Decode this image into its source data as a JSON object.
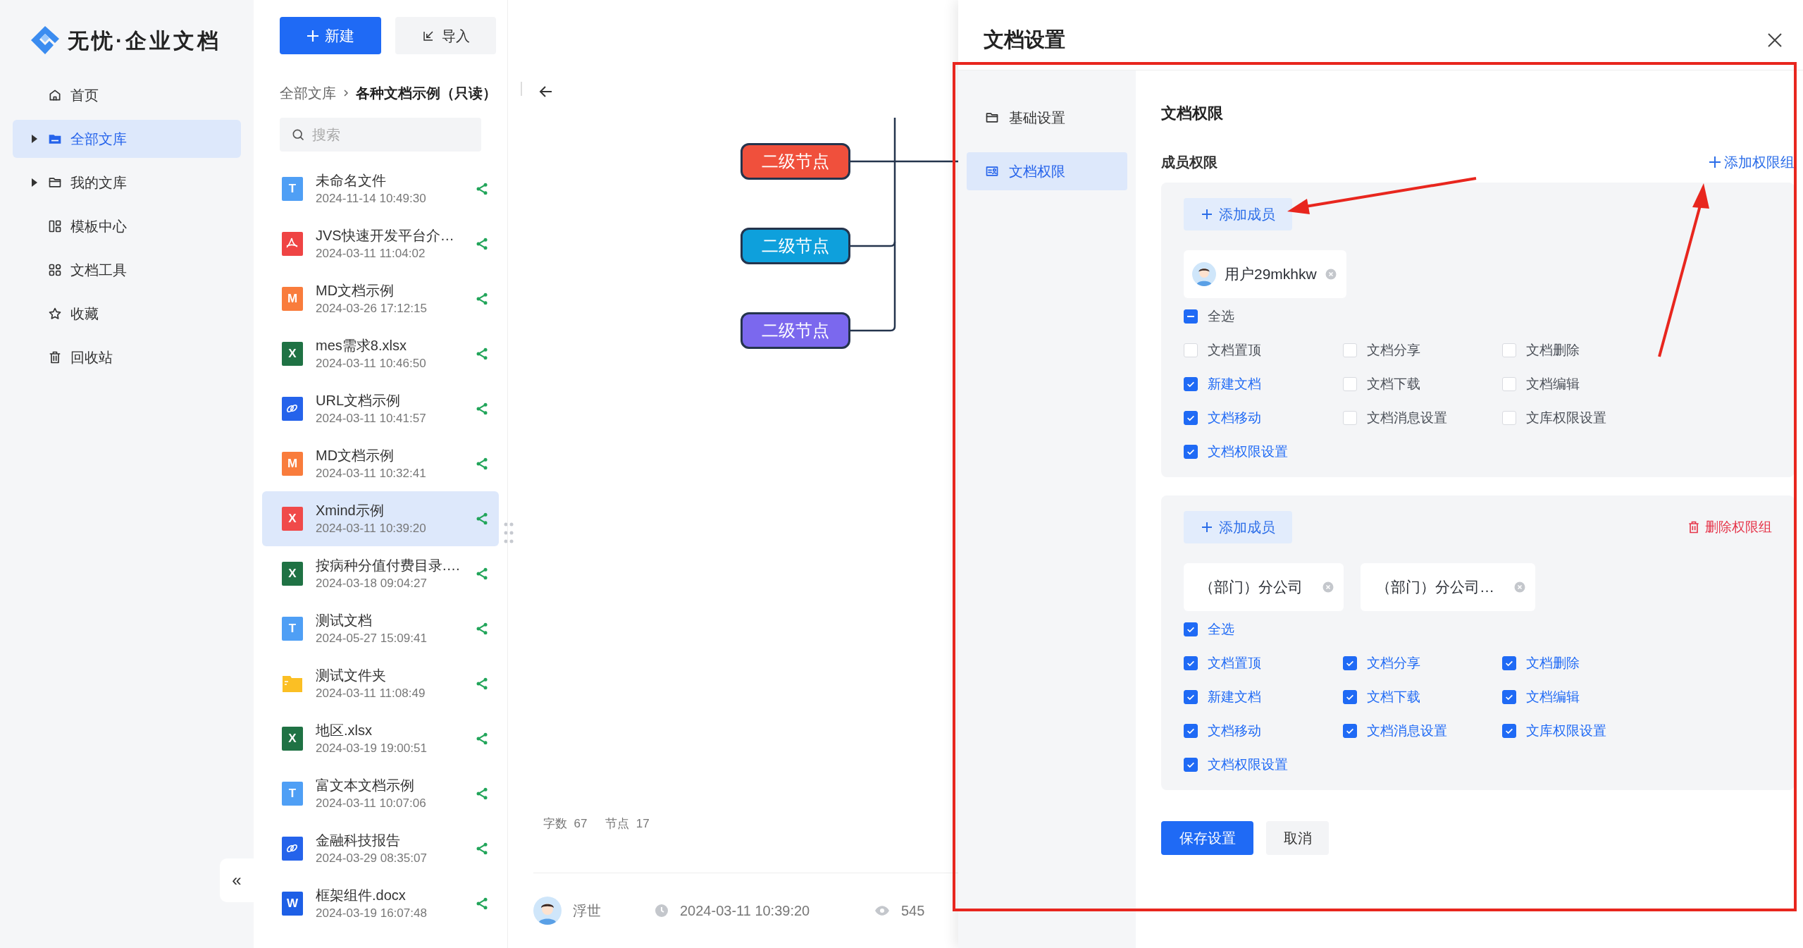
{
  "brand": {
    "title": "无忧·企业文档"
  },
  "sidebar": {
    "items": [
      {
        "label": "首页",
        "expandable": false,
        "selected": false
      },
      {
        "label": "全部文库",
        "expandable": true,
        "selected": true
      },
      {
        "label": "我的文库",
        "expandable": true,
        "selected": false
      },
      {
        "label": "模板中心",
        "expandable": false,
        "selected": false
      },
      {
        "label": "文档工具",
        "expandable": false,
        "selected": false
      },
      {
        "label": "收藏",
        "expandable": false,
        "selected": false
      },
      {
        "label": "回收站",
        "expandable": false,
        "selected": false
      }
    ],
    "collapse_button": "«"
  },
  "toolbar": {
    "new_button": "新建",
    "import_button": "导入"
  },
  "breadcrumb": {
    "root": "全部文库",
    "current": "各种文档示例（只读）"
  },
  "search": {
    "placeholder": "搜索"
  },
  "files": [
    {
      "kind": "text",
      "letter": "T",
      "name": "未命名文件",
      "date": "2024-11-14 10:49:30",
      "selected": false
    },
    {
      "kind": "pdf",
      "name": "JVS快速开发平台介…",
      "date": "2024-03-11 11:04:02",
      "selected": false
    },
    {
      "kind": "md",
      "letter": "M",
      "name": "MD文档示例",
      "date": "2024-03-26 17:12:15",
      "selected": false
    },
    {
      "kind": "excel",
      "letter": "X",
      "name": "mes需求8.xlsx",
      "date": "2024-03-11 10:46:50",
      "selected": false
    },
    {
      "kind": "link",
      "name": "URL文档示例",
      "date": "2024-03-11 10:41:57",
      "selected": false
    },
    {
      "kind": "md",
      "letter": "M",
      "name": "MD文档示例",
      "date": "2024-03-11 10:32:41",
      "selected": false
    },
    {
      "kind": "xmind",
      "letter": "X",
      "name": "Xmind示例",
      "date": "2024-03-11 10:39:20",
      "selected": true
    },
    {
      "kind": "excel",
      "letter": "X",
      "name": "按病种分值付费目录.…",
      "date": "2024-03-18 09:04:27",
      "selected": false
    },
    {
      "kind": "text",
      "letter": "T",
      "name": "测试文档",
      "date": "2024-05-27 15:09:41",
      "selected": false
    },
    {
      "kind": "folder",
      "name": "测试文件夹",
      "date": "2024-03-11 11:08:49",
      "selected": false
    },
    {
      "kind": "excel",
      "letter": "X",
      "name": "地区.xlsx",
      "date": "2024-03-19 19:00:51",
      "selected": false
    },
    {
      "kind": "text",
      "letter": "T",
      "name": "富文本文档示例",
      "date": "2024-03-11 10:07:06",
      "selected": false
    },
    {
      "kind": "link",
      "name": "金融科技报告",
      "date": "2024-03-29 08:35:07",
      "selected": false
    },
    {
      "kind": "word",
      "letter": "W",
      "name": "框架组件.docx",
      "date": "2024-03-19 16:07:48",
      "selected": false
    }
  ],
  "mindmap": {
    "nodes": [
      {
        "label": "二级节点",
        "color": "#f0503c"
      },
      {
        "label": "二级节点",
        "color": "#0ea0dc"
      },
      {
        "label": "二级节点",
        "color": "#7b68ee"
      }
    ],
    "stats": [
      {
        "label": "字数",
        "value": "67"
      },
      {
        "label": "节点",
        "value": "17"
      }
    ]
  },
  "doc_footer": {
    "author": "浮世",
    "time": "2024-03-11 10:39:20",
    "views": "545"
  },
  "drawer": {
    "title": "文档设置",
    "nav": [
      {
        "label": "基础设置",
        "selected": false
      },
      {
        "label": "文档权限",
        "selected": true
      }
    ],
    "heading": "文档权限",
    "section": "成员权限",
    "add_group": "添加权限组",
    "groups": [
      {
        "add_member": "添加成员",
        "members": [
          {
            "kind": "user",
            "name": "用户29mkhkw"
          }
        ],
        "select_all": {
          "label": "全选",
          "checked": false,
          "indeterminate": true
        },
        "permissions": [
          {
            "label": "文档置顶",
            "checked": false
          },
          {
            "label": "文档分享",
            "checked": false
          },
          {
            "label": "文档删除",
            "checked": false
          },
          {
            "label": "新建文档",
            "checked": true
          },
          {
            "label": "文档下载",
            "checked": false
          },
          {
            "label": "文档编辑",
            "checked": false
          },
          {
            "label": "文档移动",
            "checked": true
          },
          {
            "label": "文档消息设置",
            "checked": false
          },
          {
            "label": "文库权限设置",
            "checked": false
          },
          {
            "label": "文档权限设置",
            "checked": true
          }
        ]
      },
      {
        "add_member": "添加成员",
        "delete_group": "删除权限组",
        "members": [
          {
            "kind": "department",
            "name": "（部门）分公司"
          },
          {
            "kind": "department",
            "name": "（部门）分公司…"
          }
        ],
        "select_all": {
          "label": "全选",
          "checked": true,
          "indeterminate": false
        },
        "permissions": [
          {
            "label": "文档置顶",
            "checked": true
          },
          {
            "label": "文档分享",
            "checked": true
          },
          {
            "label": "文档删除",
            "checked": true
          },
          {
            "label": "新建文档",
            "checked": true
          },
          {
            "label": "文档下载",
            "checked": true
          },
          {
            "label": "文档编辑",
            "checked": true
          },
          {
            "label": "文档移动",
            "checked": true
          },
          {
            "label": "文档消息设置",
            "checked": true
          },
          {
            "label": "文库权限设置",
            "checked": true
          },
          {
            "label": "文档权限设置",
            "checked": true
          }
        ]
      }
    ],
    "save_button": "保存设置",
    "cancel_button": "取消"
  }
}
